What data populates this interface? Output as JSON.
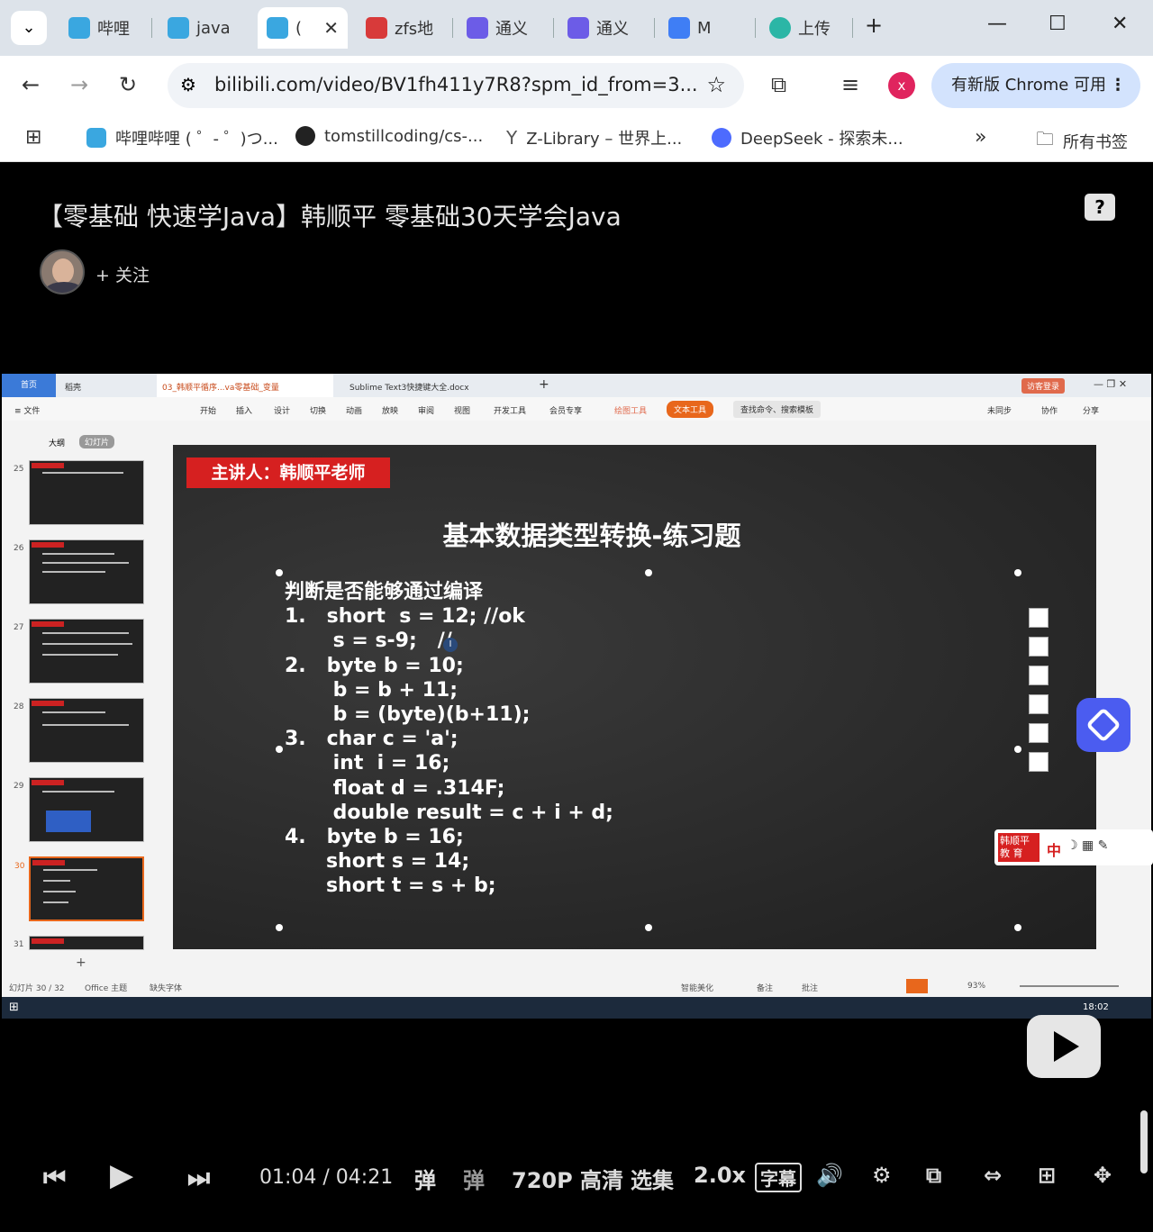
{
  "browser": {
    "tabs": [
      {
        "label": "哔哩",
        "color": "#3aa7e0"
      },
      {
        "label": "java",
        "color": "#3aa7e0"
      },
      {
        "label": "(",
        "color": "#3aa7e0"
      },
      {
        "label": "zfs地",
        "color": "#d83a3a"
      },
      {
        "label": "通义",
        "color": "#6c5ce7"
      },
      {
        "label": "通义",
        "color": "#6c5ce7"
      },
      {
        "label": "M",
        "color": "#3f7ef5"
      },
      {
        "label": "上传",
        "color": "#2bb6a6"
      }
    ],
    "url": "bilibili.com/video/BV1fh411y7R8?spm_id_from=3...",
    "update_button": "有新版 Chrome 可用",
    "profile_initial": "x"
  },
  "bookmarks": {
    "items": [
      "哔哩哔哩 ( ゜- ゜)つ...",
      "tomstillcoding/cs-...",
      "Z-Library – 世界上...",
      "DeepSeek - 探索未..."
    ],
    "more": "»",
    "all_bookmarks": "所有书签"
  },
  "video": {
    "title": "【零基础 快速学Java】韩顺平 零基础30天学会Java",
    "follow_label": "+ 关注",
    "help_label": "?"
  },
  "wps": {
    "tabs": [
      "首页",
      "稻壳",
      "03_韩顺平循序...va零基础_变量",
      "Sublime Text3快捷键大全.docx"
    ],
    "login_label": "访客登录",
    "menu": [
      "≡ 文件",
      "开始",
      "插入",
      "设计",
      "切换",
      "动画",
      "放映",
      "审阅",
      "视图",
      "开发工具",
      "会员专享",
      "绘图工具",
      "文本工具",
      "查找命令、搜索模板",
      "未同步",
      "协作",
      "分享"
    ],
    "panel_tabs": [
      "大纲",
      "幻灯片"
    ],
    "slide_numbers": [
      "25",
      "26",
      "27",
      "28",
      "29",
      "30",
      "31"
    ],
    "status_left": "幻灯片 30 / 32",
    "theme": "Office 主题",
    "font_missing": "缺失字体",
    "status_right": [
      "智能美化",
      "备注",
      "批注"
    ],
    "zoom": "93%",
    "clock": "18:02"
  },
  "slide": {
    "presenter": "主讲人：韩顺平老师",
    "title": "基本数据类型转换-练习题",
    "code": "判断是否能够通过编译\n1.   short  s = 12; //ok\n       s = s-9;   //\n2.   byte b = 10;\n       b = b + 11;\n       b = (byte)(b+11);\n3.   char c = 'a';\n       int  i = 16;\n       float d = .314F;\n       double result = c + i + d;\n4.   byte b = 16;\n      short s = 14;\n      short t = s + b;"
  },
  "ime": {
    "brand": "韩顺平\n教 育",
    "label": "中"
  },
  "player": {
    "time": "01:04  /  04:21",
    "quality": "720P 高清",
    "episodes": "选集",
    "speed": "2.0x",
    "subtitle": "字幕"
  }
}
